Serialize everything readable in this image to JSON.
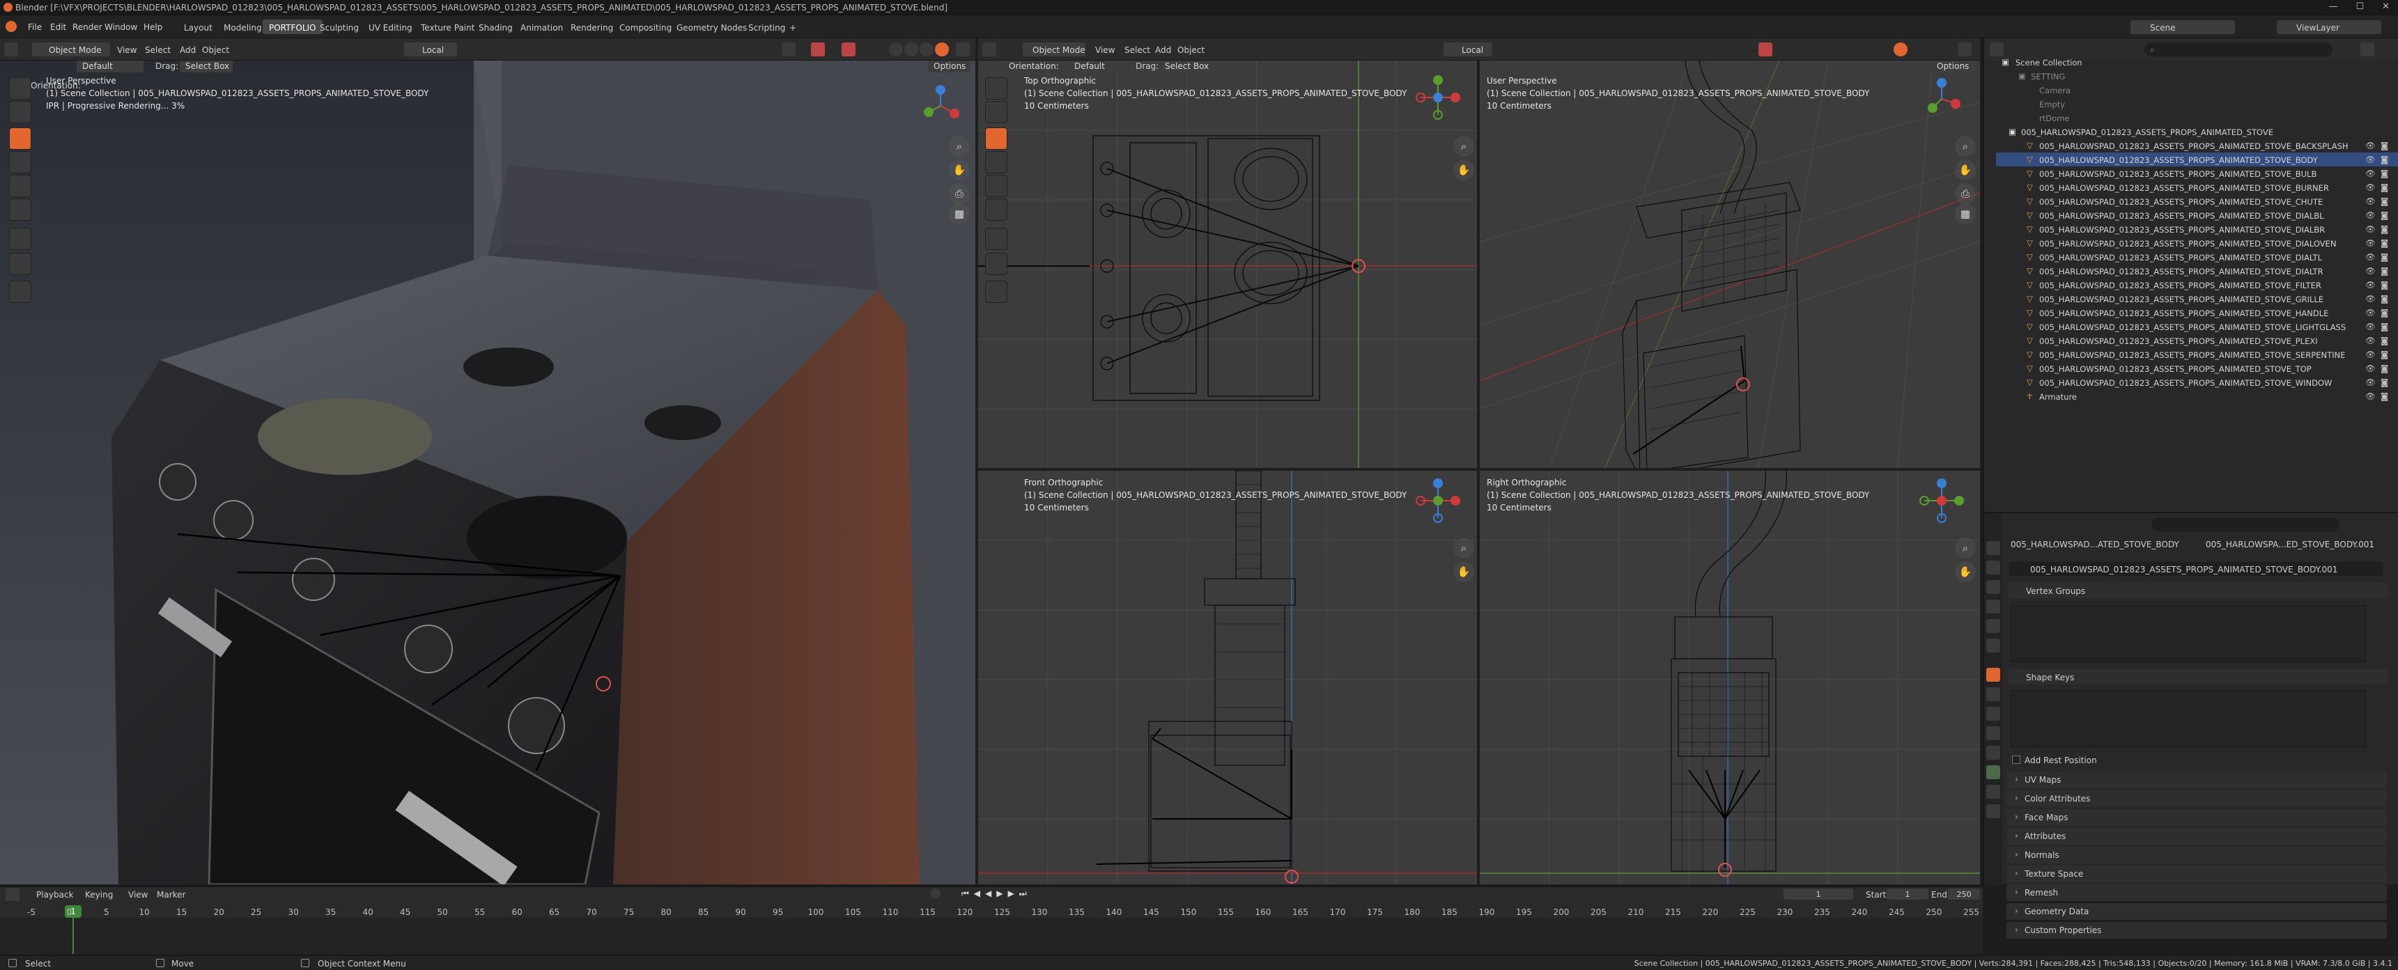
{
  "title": "Blender [F:\\VFX\\PROJECTS\\BLENDER\\HARLOWSPAD_012823\\005_HARLOWSPAD_012823_ASSETS\\005_HARLOWSPAD_012823_ASSETS_PROPS_ANIMATED\\005_HARLOWSPAD_012823_ASSETS_PROPS_ANIMATED_STOVE.blend]",
  "menus": [
    "File",
    "Edit",
    "Render",
    "Window",
    "Help"
  ],
  "workspaces": [
    "Layout",
    "Modeling",
    "PORTFOLIO",
    "Sculpting",
    "UV Editing",
    "Texture Paint",
    "Shading",
    "Animation",
    "Rendering",
    "Compositing",
    "Geometry Nodes",
    "Scripting",
    "+"
  ],
  "header": {
    "mode": "Object Mode",
    "view": "View",
    "select": "Select",
    "add": "Add",
    "object": "Object",
    "transform": "Local",
    "orientation_label": "Orientation:",
    "orientation": "Default",
    "drag_label": "Drag:",
    "drag": "Select Box",
    "options": "Options"
  },
  "scene": {
    "scene_label": "Scene",
    "view_layer": "ViewLayer"
  },
  "viewports": {
    "main": {
      "title": "User Perspective",
      "line2": "(1) Scene Collection | 005_HARLOWSPAD_012823_ASSETS_PROPS_ANIMATED_STOVE_BODY",
      "line3": "IPR | Progressive Rendering... 3%"
    },
    "top": {
      "title": "Top Orthographic",
      "line2": "(1) Scene Collection | 005_HARLOWSPAD_012823_ASSETS_PROPS_ANIMATED_STOVE_BODY",
      "line3": "10 Centimeters"
    },
    "user2": {
      "title": "User Perspective",
      "line2": "(1) Scene Collection | 005_HARLOWSPAD_012823_ASSETS_PROPS_ANIMATED_STOVE_BODY",
      "line3": "10 Centimeters"
    },
    "front": {
      "title": "Front Orthographic",
      "line2": "(1) Scene Collection | 005_HARLOWSPAD_012823_ASSETS_PROPS_ANIMATED_STOVE_BODY",
      "line3": "10 Centimeters"
    },
    "right": {
      "title": "Right Orthographic",
      "line2": "(1) Scene Collection | 005_HARLOWSPAD_012823_ASSETS_PROPS_ANIMATED_STOVE_BODY",
      "line3": "10 Centimeters"
    }
  },
  "outliner": {
    "root": "Scene Collection",
    "setting": "SETTING",
    "setting_items": [
      "Camera",
      "Empty",
      "rtDome"
    ],
    "collection": "005_HARLOWSPAD_012823_ASSETS_PROPS_ANIMATED_STOVE",
    "items": [
      "005_HARLOWSPAD_012823_ASSETS_PROPS_ANIMATED_STOVE_BACKSPLASH",
      "005_HARLOWSPAD_012823_ASSETS_PROPS_ANIMATED_STOVE_BODY",
      "005_HARLOWSPAD_012823_ASSETS_PROPS_ANIMATED_STOVE_BULB",
      "005_HARLOWSPAD_012823_ASSETS_PROPS_ANIMATED_STOVE_BURNER",
      "005_HARLOWSPAD_012823_ASSETS_PROPS_ANIMATED_STOVE_CHUTE",
      "005_HARLOWSPAD_012823_ASSETS_PROPS_ANIMATED_STOVE_DIALBL",
      "005_HARLOWSPAD_012823_ASSETS_PROPS_ANIMATED_STOVE_DIALBR",
      "005_HARLOWSPAD_012823_ASSETS_PROPS_ANIMATED_STOVE_DIALOVEN",
      "005_HARLOWSPAD_012823_ASSETS_PROPS_ANIMATED_STOVE_DIALTL",
      "005_HARLOWSPAD_012823_ASSETS_PROPS_ANIMATED_STOVE_DIALTR",
      "005_HARLOWSPAD_012823_ASSETS_PROPS_ANIMATED_STOVE_FILTER",
      "005_HARLOWSPAD_012823_ASSETS_PROPS_ANIMATED_STOVE_GRILLE",
      "005_HARLOWSPAD_012823_ASSETS_PROPS_ANIMATED_STOVE_HANDLE",
      "005_HARLOWSPAD_012823_ASSETS_PROPS_ANIMATED_STOVE_LIGHTGLASS",
      "005_HARLOWSPAD_012823_ASSETS_PROPS_ANIMATED_STOVE_PLEXI",
      "005_HARLOWSPAD_012823_ASSETS_PROPS_ANIMATED_STOVE_SERPENTINE",
      "005_HARLOWSPAD_012823_ASSETS_PROPS_ANIMATED_STOVE_TOP",
      "005_HARLOWSPAD_012823_ASSETS_PROPS_ANIMATED_STOVE_WINDOW",
      "Armature"
    ]
  },
  "properties": {
    "breadcrumb1": "005_HARLOWSPAD...ATED_STOVE_BODY",
    "breadcrumb2": "005_HARLOWSPA...ED_STOVE_BODY.001",
    "mesh_name": "005_HARLOWSPAD_012823_ASSETS_PROPS_ANIMATED_STOVE_BODY.001",
    "vertex_groups": "Vertex Groups",
    "shape_keys": "Shape Keys",
    "add_rest_position": "Add Rest Position",
    "sections": [
      "UV Maps",
      "Color Attributes",
      "Face Maps",
      "Attributes",
      "Normals",
      "Texture Space",
      "Remesh",
      "Geometry Data",
      "Custom Properties"
    ]
  },
  "timeline": {
    "playback": "Playback",
    "keying": "Keying",
    "view": "View",
    "marker": "Marker",
    "current_frame": "1",
    "start_label": "Start",
    "start": "1",
    "end_label": "End",
    "end": "250",
    "frame_marker": "1",
    "ticks": [
      "-5",
      "0",
      "5",
      "10",
      "15",
      "20",
      "25",
      "30",
      "35",
      "40",
      "45",
      "50",
      "55",
      "60",
      "65",
      "70",
      "75",
      "80",
      "85",
      "90",
      "95",
      "100",
      "105",
      "110",
      "115",
      "120",
      "125",
      "130",
      "135",
      "140",
      "145",
      "150",
      "155",
      "160",
      "165",
      "170",
      "175",
      "180",
      "185",
      "190",
      "195",
      "200",
      "205",
      "210",
      "215",
      "220",
      "225",
      "230",
      "235",
      "240",
      "245",
      "250",
      "255"
    ]
  },
  "status": {
    "select": "Select",
    "move": "Move",
    "context": "Object Context Menu",
    "stats": "Scene Collection | 005_HARLOWSPAD_012823_ASSETS_PROPS_ANIMATED_STOVE_BODY | Verts:284,391 | Faces:288,425 | Tris:548,133 | Objects:0/20 | Memory: 161.8 MiB | VRAM: 7.3/8.0 GiB | 3.4.1"
  },
  "colors": {
    "accent": "#e2662f",
    "selection": "#ff8c00",
    "x_axis": "#d23a3a",
    "y_axis": "#5a9e2e",
    "z_axis": "#3a7fd6"
  }
}
